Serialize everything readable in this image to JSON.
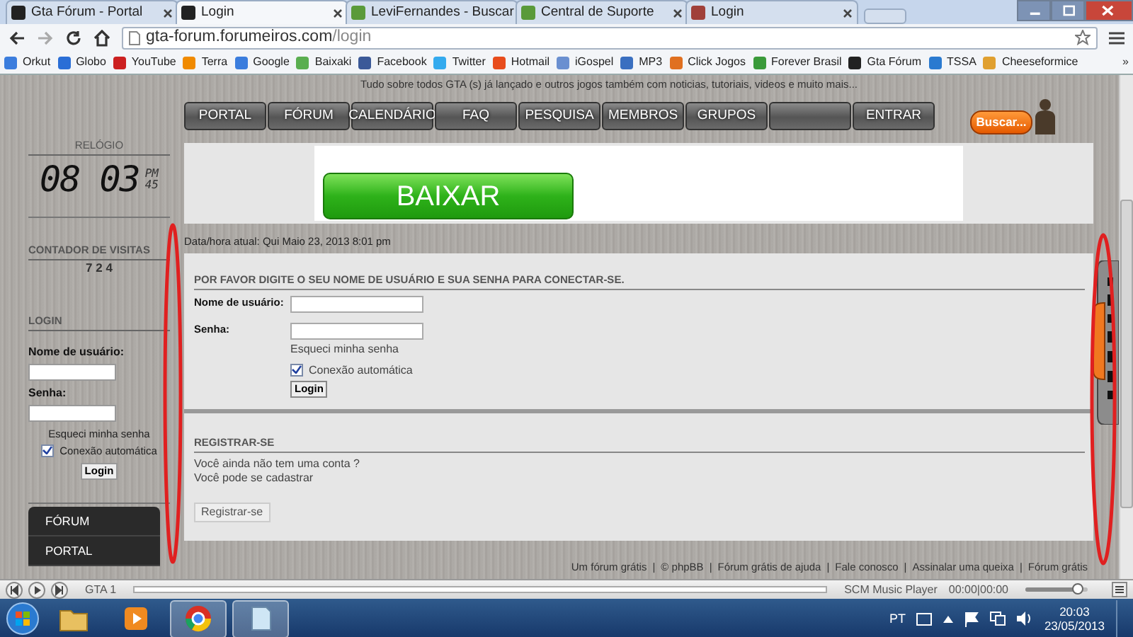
{
  "browser": {
    "tabs": [
      {
        "title": "Gta Fórum - Portal",
        "selected": false,
        "color": "#222222"
      },
      {
        "title": "Login",
        "selected": true,
        "color": "#222222"
      },
      {
        "title": "LeviFernandes - Buscar",
        "selected": false,
        "color": "#5a9a3a"
      },
      {
        "title": "Central de Suporte",
        "selected": false,
        "color": "#5a9a3a"
      },
      {
        "title": "Login",
        "selected": false,
        "color": "#a0403a"
      }
    ],
    "address": {
      "host": "gta-forum.forumeiros.com",
      "path": "/login"
    },
    "bookmarks": [
      {
        "label": "Orkut",
        "color": "#3b7ddd"
      },
      {
        "label": "Globo",
        "color": "#2a6ed6"
      },
      {
        "label": "YouTube",
        "color": "#cc2020"
      },
      {
        "label": "Terra",
        "color": "#f08a00"
      },
      {
        "label": "Google",
        "color": "#3b7ddd"
      },
      {
        "label": "Baixaki",
        "color": "#5aae4f"
      },
      {
        "label": "Facebook",
        "color": "#3b5998"
      },
      {
        "label": "Twitter",
        "color": "#33aaee"
      },
      {
        "label": "Hotmail",
        "color": "#e84c1c"
      },
      {
        "label": "iGospel",
        "color": "#6a8fd0"
      },
      {
        "label": "MP3",
        "color": "#3a6fc0"
      },
      {
        "label": "Click Jogos",
        "color": "#e07020"
      },
      {
        "label": "Forever Brasil",
        "color": "#3a9a3a"
      },
      {
        "label": "Gta Fórum",
        "color": "#222222"
      },
      {
        "label": "TSSA",
        "color": "#2a7ad0"
      },
      {
        "label": "Cheeseformice",
        "color": "#e0a030"
      }
    ],
    "bookmarks_more": "»"
  },
  "page": {
    "tagline": "Tudo sobre todos GTA (s) já lançado e outros jogos também com noticias, tutoriais, videos e muito mais...",
    "nav": [
      {
        "kind": "link",
        "label": "PORTAL"
      },
      {
        "kind": "link",
        "label": "FÓRUM"
      },
      {
        "kind": "link",
        "label": "CALENDÁRIO"
      },
      {
        "kind": "link",
        "label": "FAQ"
      },
      {
        "kind": "link",
        "label": "PESQUISA"
      },
      {
        "kind": "link",
        "label": "MEMBROS"
      },
      {
        "kind": "link",
        "label": "GRUPOS"
      },
      {
        "kind": "blank"
      },
      {
        "kind": "link",
        "label": "ENTRAR"
      }
    ],
    "search_button": "Buscar...",
    "sidebar": {
      "clock": {
        "title": "RELÓGIO",
        "hours": "08",
        "minutes": "03",
        "ampm": "PM",
        "seconds": "45"
      },
      "visits": {
        "title": "CONTADOR DE VISITAS",
        "count": "7 2 4"
      },
      "login": {
        "title": "LOGIN",
        "username_label": "Nome de usuário:",
        "password_label": "Senha:",
        "forgot": "Esqueci minha senha",
        "auto_login": {
          "label": "Conexão automática",
          "checked": true
        },
        "button": "Login"
      },
      "menu": [
        "FÓRUM",
        "PORTAL"
      ]
    },
    "banner": {
      "button": "BAIXAR"
    },
    "datetime": "Data/hora atual: Qui Maio 23, 2013 8:01 pm",
    "login_form": {
      "heading": "POR FAVOR DIGITE O SEU NOME DE USUÁRIO E SUA SENHA PARA CONECTAR-SE.",
      "username_label": "Nome de usuário:",
      "password_label": "Senha:",
      "forgot": "Esqueci minha senha",
      "auto_login": {
        "label": "Conexão automática",
        "checked": true
      },
      "button": "Login"
    },
    "register": {
      "heading": "REGISTRAR-SE",
      "lines": [
        "Você ainda não tem uma conta ?",
        "Você pode se cadastrar"
      ],
      "button": "Registrar-se"
    },
    "footer_links": [
      "Um fórum grátis",
      "© phpBB",
      "Fórum grátis de ajuda",
      "Fale conosco",
      "Assinalar uma queixa",
      "Fórum grátis"
    ],
    "footer_separator": "|"
  },
  "player": {
    "track": "GTA 1",
    "name": "SCM Music Player",
    "time": "00:00|00:00",
    "volume": {
      "level": 0.85
    }
  },
  "taskbar": {
    "apps": [
      {
        "kind": "folder",
        "selected": false
      },
      {
        "kind": "media",
        "selected": false
      },
      {
        "kind": "browser",
        "selected": true
      },
      {
        "kind": "notes",
        "selected": true
      }
    ],
    "language": "PT",
    "time": "20:03",
    "date": "23/05/2013"
  }
}
